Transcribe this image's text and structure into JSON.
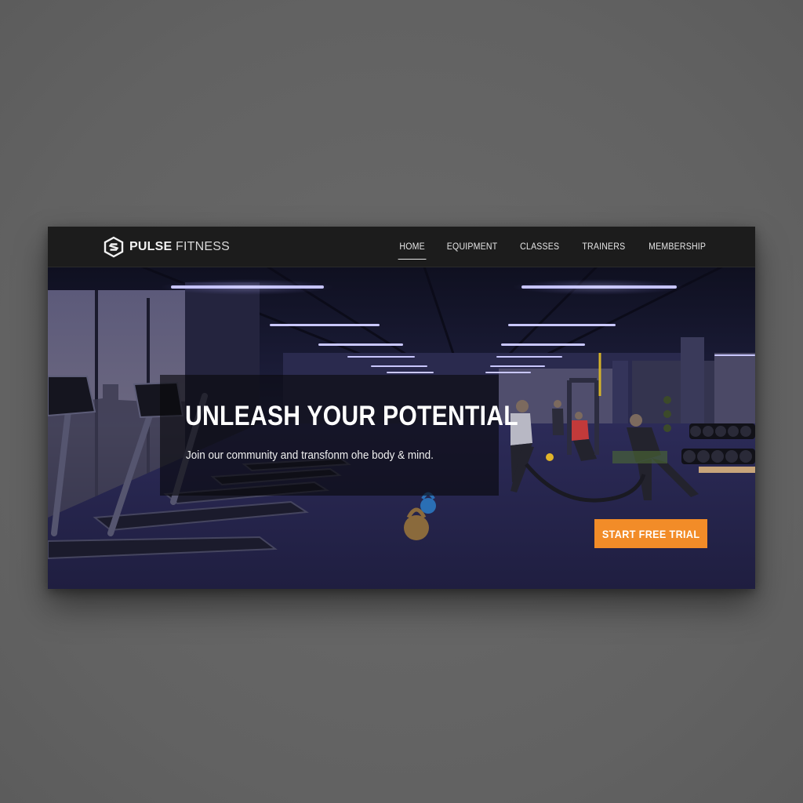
{
  "brand": {
    "name_bold": "PULSE",
    "name_light": "FITNESS",
    "logo_icon": "hexagon-s-logo-icon"
  },
  "nav": {
    "items": [
      {
        "label": "HOME",
        "active": true
      },
      {
        "label": "EQUIPMENT",
        "active": false
      },
      {
        "label": "CLASSES",
        "active": false
      },
      {
        "label": "TRAINERS",
        "active": false
      },
      {
        "label": "MEMBERSHIP",
        "active": false
      }
    ]
  },
  "hero": {
    "headline": "UNLEASH YOUR POTENTIAL",
    "subline": "Join our community and transfonm ohe body & mind.",
    "cta_label": "START FREE TRIAL"
  },
  "colors": {
    "accent": "#f28c28",
    "navbar_bg": "#1c1c1c",
    "page_bg": "#666666",
    "ceiling_light": "#b9b6ff"
  }
}
